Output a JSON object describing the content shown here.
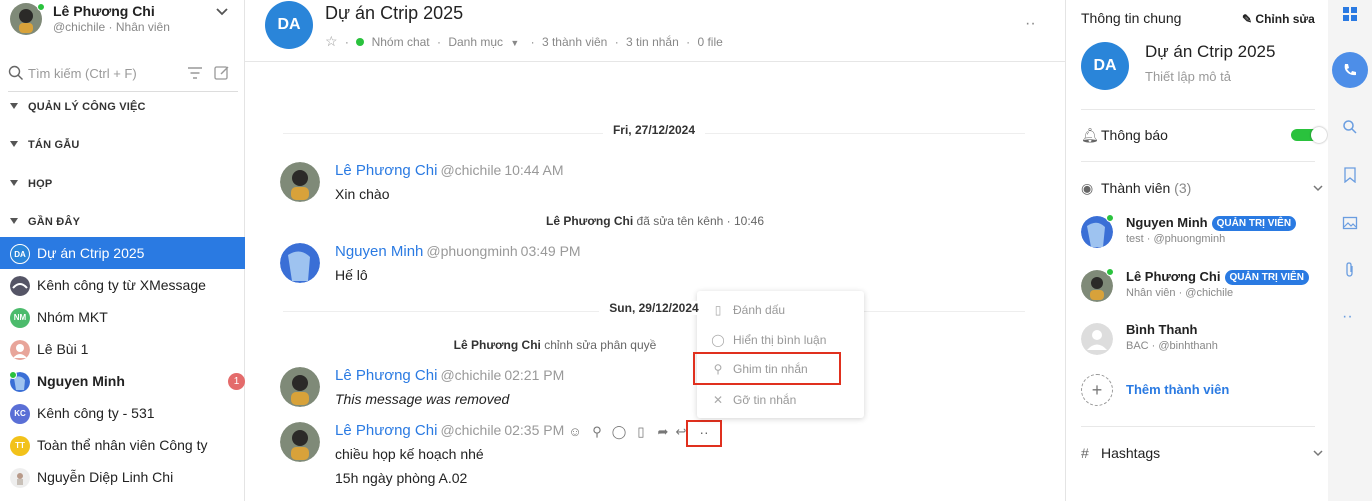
{
  "user": {
    "name": "Lê Phương Chi",
    "sub": "@chichile · Nhân viên"
  },
  "search": {
    "placeholder": "Tìm kiếm (Ctrl + F)"
  },
  "sections": [
    "QUẢN LÝ CÔNG VIỆC",
    "TÁN GẪU",
    "HỌP",
    "GẦN ĐÂY"
  ],
  "conversations": [
    {
      "label": "Dự án Ctrip 2025",
      "initials": "DA",
      "color": "#2a85d9",
      "active": true
    },
    {
      "label": "Kênh công ty từ XMessage",
      "initials": "",
      "color": "#555566"
    },
    {
      "label": "Nhóm MKT",
      "initials": "NM",
      "color": "#4cbb6c"
    },
    {
      "label": "Lê Bùi 1",
      "initials": "",
      "color": "#e8a59a"
    },
    {
      "label": "Nguyen Minh",
      "initials": "",
      "color": "#3a6fd6",
      "bold": true,
      "badge": "1"
    },
    {
      "label": "Kênh công ty - 531",
      "initials": "KC",
      "color": "#5a6fd6"
    },
    {
      "label": "Toàn thể nhân viên Công ty",
      "initials": "TT",
      "color": "#f2c21a"
    },
    {
      "label": "Nguyễn Diệp Linh Chi",
      "initials": "",
      "color": "#d9d4d0"
    }
  ],
  "channel": {
    "initials": "DA",
    "title": "Dự án Ctrip 2025",
    "type": "Nhóm chat",
    "category": "Danh mục",
    "members": "3 thành viên",
    "messages": "3 tin nhắn",
    "files": "0 file"
  },
  "chat": {
    "date1": "Fri, 27/12/2024",
    "date2": "Sun, 29/12/2024",
    "m1": {
      "name": "Lê Phương Chi",
      "handle": "@chichile",
      "time": "10:44 AM",
      "text": "Xin chào"
    },
    "sys1": {
      "actor": "Lê Phương Chi",
      "action": "đã sửa tên kênh · 10:46"
    },
    "m2": {
      "name": "Nguyen Minh",
      "handle": "@phuongminh",
      "time": "03:49 PM",
      "text": "Hế lô"
    },
    "sys2": {
      "actor": "Lê Phương Chi",
      "action": "chỉnh sửa phân quyề"
    },
    "m3": {
      "name": "Lê Phương Chi",
      "handle": "@chichile",
      "time": "02:21 PM",
      "text": "This message was removed"
    },
    "m4": {
      "name": "Lê Phương Chi",
      "handle": "@chichile",
      "time": "02:35 PM",
      "line1": "chiều họp kế hoạch nhé",
      "line2": "15h ngày phòng A.02"
    }
  },
  "context_menu": {
    "items": [
      "Đánh dấu",
      "Hiển thị bình luận",
      "Ghim tin nhắn",
      "Gỡ tin nhắn"
    ]
  },
  "info": {
    "title": "Thông tin chung",
    "edit": "Chỉnh sửa",
    "name": "Dự án Ctrip 2025",
    "desc": "Thiết lập mô tả",
    "notify": "Thông báo",
    "members_label": "Thành viên",
    "members_count": "(3)",
    "members": [
      {
        "name": "Nguyen Minh",
        "role": "QUẢN TRỊ VIÊN",
        "sub": "test · @phuongminh"
      },
      {
        "name": "Lê Phương Chi",
        "role": "QUẢN TRỊ VIÊN",
        "sub": "Nhân viên · @chichile"
      },
      {
        "name": "Bình Thanh",
        "role": "",
        "sub": "BAC · @binhthanh"
      }
    ],
    "add_member": "Thêm thành viên",
    "hashtags": "Hashtags"
  },
  "colors": {
    "accent": "#2a7ae2",
    "online": "#2ac23d",
    "highlight_box": "#e0301e"
  }
}
